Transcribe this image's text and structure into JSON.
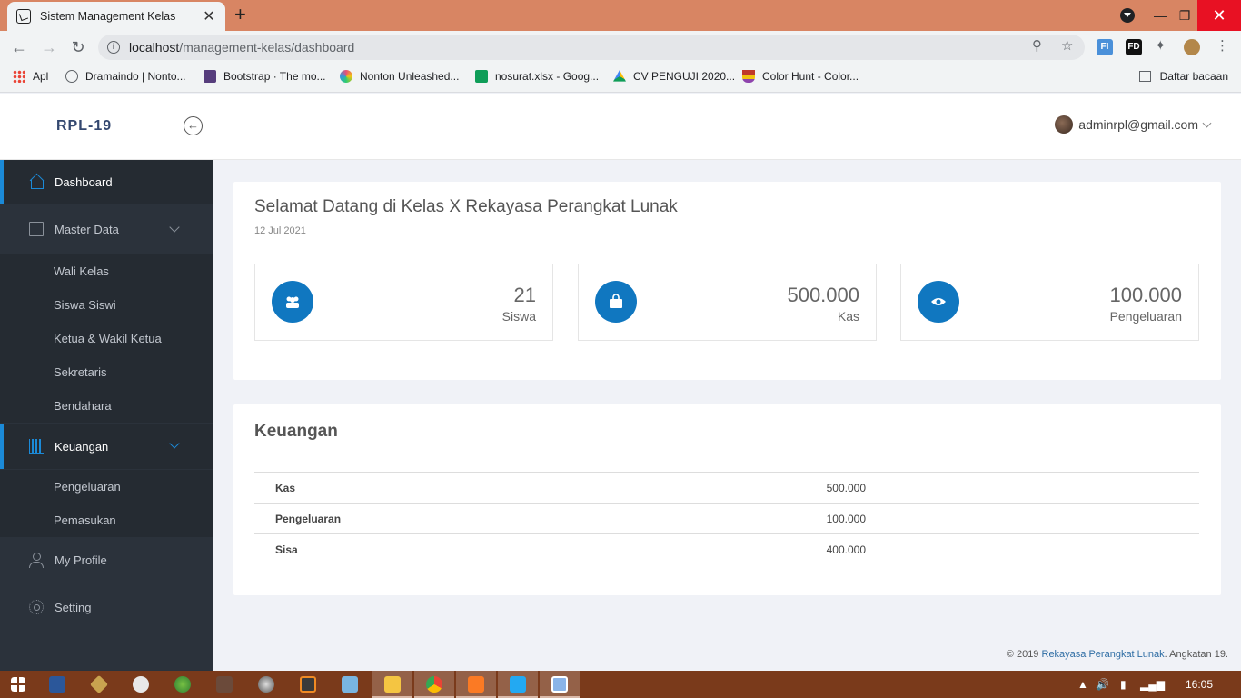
{
  "browser": {
    "tab_title": "Sistem Management Kelas",
    "tab_close": "✕",
    "new_tab": "+",
    "url_host": "localhost",
    "url_path": "/management-kelas/dashboard",
    "bookmarks": [
      {
        "label": "Apl",
        "color": "#ea4335"
      },
      {
        "label": "Dramaindo | Nonto...",
        "color": "#5f6368"
      },
      {
        "label": "Bootstrap · The mo...",
        "color": "#563d7c"
      },
      {
        "label": "Nonton Unleashed...",
        "color": "#e94e77"
      },
      {
        "label": "nosurat.xlsx - Goog...",
        "color": "#0f9d58"
      },
      {
        "label": "CV PENGUJI 2020...",
        "color": "#fbbc04"
      },
      {
        "label": "Color Hunt - Color...",
        "color": "#c0392b"
      }
    ],
    "reading_list": "Daftar bacaan"
  },
  "app": {
    "brand": "RPL-19",
    "user_email": "adminrpl@gmail.com"
  },
  "sidebar": {
    "dashboard": "Dashboard",
    "master_data": "Master Data",
    "master_items": [
      "Wali Kelas",
      "Siswa Siswi",
      "Ketua & Wakil Ketua",
      "Sekretaris",
      "Bendahara"
    ],
    "keuangan": "Keuangan",
    "keuangan_items": [
      "Pengeluaran",
      "Pemasukan"
    ],
    "my_profile": "My Profile",
    "setting": "Setting"
  },
  "welcome": {
    "title": "Selamat Datang di Kelas X Rekayasa Perangkat Lunak",
    "date": "12 Jul 2021"
  },
  "stats": [
    {
      "value": "21",
      "label": "Siswa",
      "icon": "users-icon"
    },
    {
      "value": "500.000",
      "label": "Kas",
      "icon": "bag-icon"
    },
    {
      "value": "100.000",
      "label": "Pengeluaran",
      "icon": "eye-icon"
    }
  ],
  "finance": {
    "title": "Keuangan",
    "rows": [
      {
        "key": "Kas",
        "value": "500.000"
      },
      {
        "key": "Pengeluaran",
        "value": "100.000"
      },
      {
        "key": "Sisa",
        "value": "400.000"
      }
    ]
  },
  "footer": {
    "prefix": "© 2019 ",
    "link": "Rekayasa Perangkat Lunak",
    "suffix": ". Angkatan 19."
  },
  "taskbar": {
    "clock": "16:05"
  },
  "colors": {
    "accent": "#1077c0",
    "sidebar_bg": "#2b323b",
    "tabstrip": "#d88563",
    "taskbar": "#7a3a1b"
  }
}
